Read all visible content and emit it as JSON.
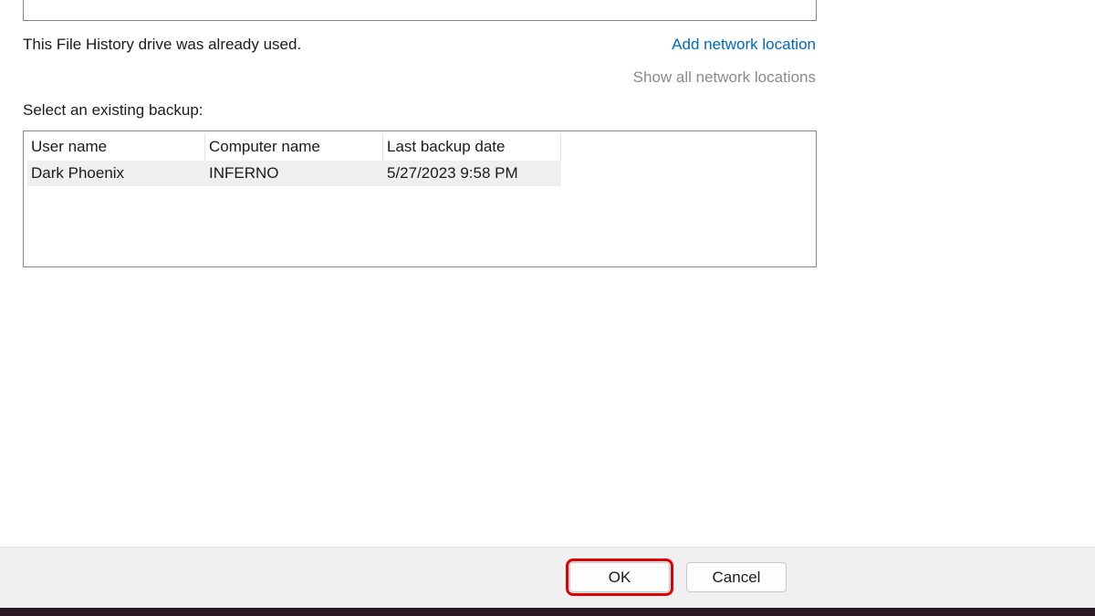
{
  "status_text": "This File History drive was already used.",
  "links": {
    "add_network": "Add network location",
    "show_all": "Show all network locations"
  },
  "select_label": "Select an existing backup:",
  "table": {
    "columns": [
      "User name",
      "Computer name",
      "Last backup date"
    ],
    "rows": [
      [
        "Dark Phoenix",
        "INFERNO",
        "5/27/2023 9:58 PM"
      ]
    ]
  },
  "buttons": {
    "ok": "OK",
    "cancel": "Cancel"
  },
  "colors": {
    "link": "#0067c0",
    "highlight": "#e00000"
  }
}
